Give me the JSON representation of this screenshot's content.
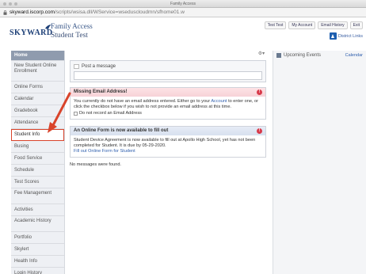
{
  "window": {
    "title": "Family Access"
  },
  "browser": {
    "url_host": "skyward.iscorp.com",
    "url_path": "/scripts/wsisa.dll/WService=wseduscloudmn/sfhome01.w"
  },
  "header": {
    "logo": "SKYWARD",
    "app_title": "Family Access",
    "page_title": "Student Test",
    "top_links": [
      "Test Test",
      "My Account",
      "Email History",
      "Exit"
    ],
    "district_links": "District Links"
  },
  "sidebar": {
    "items": [
      "Home",
      "New Student Online Enrollment",
      "Online Forms",
      "Calendar",
      "Gradebook",
      "Attendance",
      "Student Info",
      "Busing",
      "Food Service",
      "Schedule",
      "Test Scores",
      "Fee Management",
      "Activities",
      "Academic History",
      "Portfolio",
      "Skylert",
      "Health Info",
      "Login History"
    ]
  },
  "main": {
    "post_placeholder": "Post a message",
    "email_card": {
      "title": "Missing Email Address!",
      "body_1": "You currently do not have an email address entered. Either go to your ",
      "body_link": "Account",
      "body_2": " to enter one, or click the checkbox below if you wish to not provide an email address at this time.",
      "checkbox_label": "Do not record an Email Address"
    },
    "form_card": {
      "title": "An Online Form is now available to fill out",
      "body": "Student Device Agreement is now available to fill out at Apollo High School, yet has not been completed for Student.  It is due by 05-29-2020.",
      "link": "Fill out Online Form for Student"
    },
    "no_messages": "No messages were found."
  },
  "right_panel": {
    "title": "Upcoming Events",
    "calendar_link": "Calendar"
  },
  "colors": {
    "accent": "#1d3f77",
    "alert": "#d83a4a",
    "highlight": "#d9442b",
    "nav_active": "#8f9bae"
  }
}
